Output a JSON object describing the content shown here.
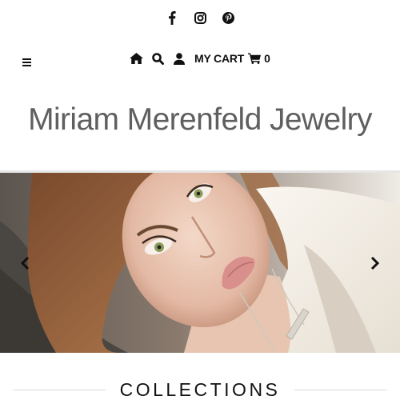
{
  "social": {
    "icons": [
      "facebook-icon",
      "instagram-icon",
      "pinterest-icon"
    ]
  },
  "nav": {
    "menu_icon": "hamburger-menu-icon",
    "icons": [
      "home-icon",
      "search-icon",
      "user-icon"
    ],
    "cart_label": "MY CART",
    "cart_icon": "shopping-cart-icon",
    "cart_count": "0"
  },
  "brand": {
    "logo_text": "Miriam Merenfeld Jewelry"
  },
  "slideshow": {
    "prev_icon": "chevron-left-icon",
    "next_icon": "chevron-right-icon"
  },
  "sections": {
    "collections_title": "COLLECTIONS"
  },
  "colors": {
    "text": "#111111",
    "logo": "#5f5f5f",
    "divider": "#e6e6e6"
  }
}
